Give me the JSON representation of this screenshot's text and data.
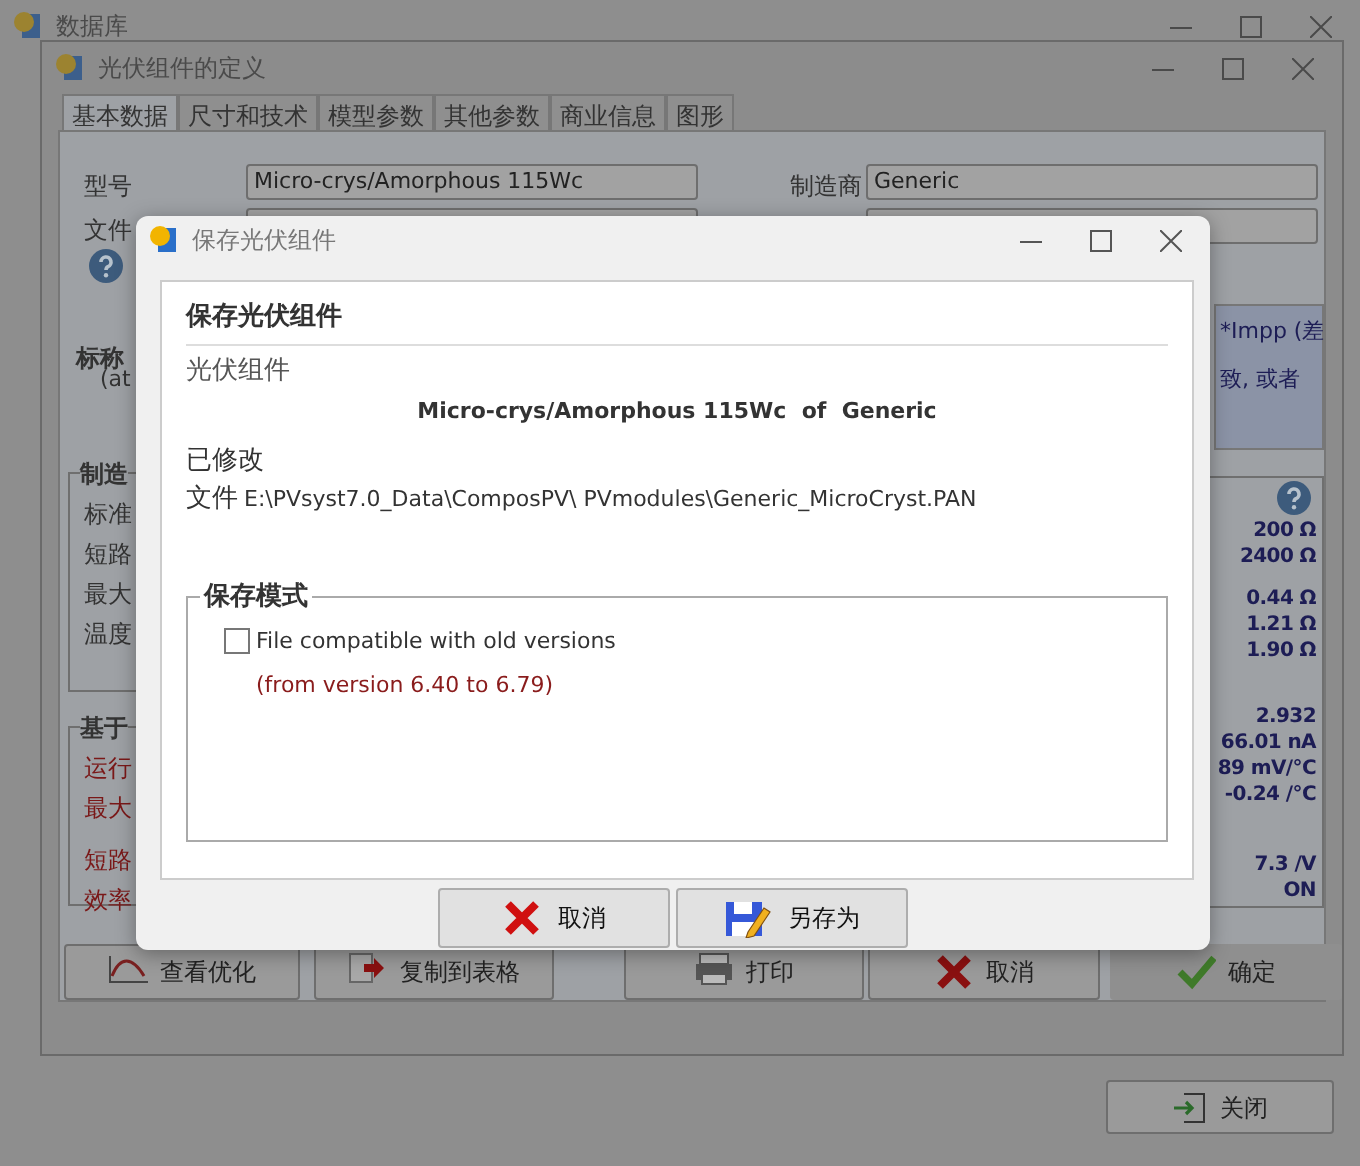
{
  "database_window": {
    "title": "数据库",
    "close_button": {
      "label": "关闭"
    }
  },
  "definition_window": {
    "title": "光伏组件的定义",
    "tabs": [
      {
        "label": "基本数据",
        "selected": true
      },
      {
        "label": "尺寸和技术",
        "selected": false
      },
      {
        "label": "模型参数",
        "selected": false
      },
      {
        "label": "其他参数",
        "selected": false
      },
      {
        "label": "商业信息",
        "selected": false
      },
      {
        "label": "图形",
        "selected": false
      }
    ],
    "fields": [
      {
        "label": "型号",
        "value": "Micro-crys/Amorphous 115Wc"
      },
      {
        "label": "制造商",
        "value": "Generic"
      },
      {
        "label": "文件"
      }
    ],
    "nominal": {
      "title": "标称",
      "lines": [
        "(at"
      ]
    },
    "groups": [
      {
        "title": "制造",
        "kind": "input",
        "labels": [
          "标准",
          "短路",
          "最大",
          "温度"
        ]
      },
      {
        "title": "基于",
        "kind": "computed",
        "labels": [
          "运行",
          "最大",
          "短路",
          "效率"
        ]
      }
    ],
    "note_box": {
      "lines": [
        "*Impp (差",
        "致, 或者"
      ]
    },
    "value_groups": [
      [
        "200 Ω",
        "2400 Ω"
      ],
      [
        "0.44 Ω",
        "1.21 Ω",
        "1.90 Ω"
      ],
      [
        "2.932",
        "66.01 nA",
        "89 mV/°C",
        "-0.24 /°C"
      ],
      [
        "7.3 /V",
        "ON"
      ]
    ],
    "buttons": [
      {
        "label": "查看优化",
        "kind": "optimize"
      },
      {
        "label": "复制到表格",
        "kind": "copy"
      },
      {
        "label": "打印",
        "kind": "print"
      },
      {
        "label": "取消",
        "kind": "cancel"
      },
      {
        "label": "确定",
        "kind": "ok"
      }
    ]
  },
  "save_dialog": {
    "title": "保存光伏组件",
    "heading": "保存光伏组件",
    "subheading": "光伏组件",
    "module": "Micro-crys/Amorphous 115Wc  of  Generic",
    "status": "已修改",
    "file_label": "文件",
    "file_path": "E:\\PVsyst7.0_Data\\ComposPV\\ PVmodules\\Generic_MicroCryst.PAN",
    "save_mode": {
      "title": "保存模式",
      "option": {
        "label": "File compatible with old versions",
        "checked": false
      },
      "note": "(from version 6.40 to 6.79)"
    },
    "buttons": [
      {
        "label": "取消",
        "kind": "cancel"
      },
      {
        "label": "另存为",
        "kind": "save_as"
      }
    ]
  }
}
